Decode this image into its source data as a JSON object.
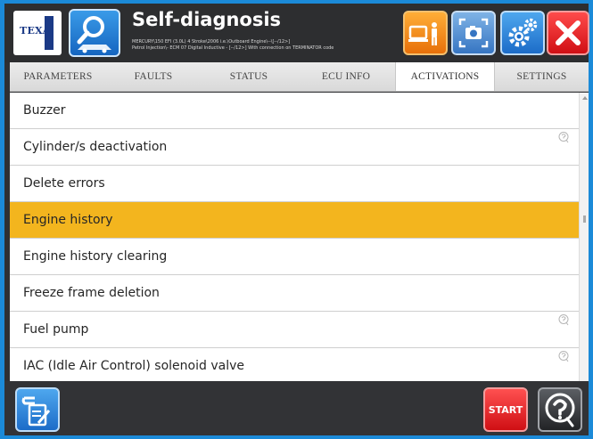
{
  "app": {
    "logo_text": "TEXA",
    "title": "Self-diagnosis",
    "subtitle_line1": "MERCURY\\150 EFI (3.0L) 4 Stroke\\2006 i.e.\\Outboard Engine\\--\\[--/12>]",
    "subtitle_line2": "Petrol Injection\\- ECM 07 Digital Inductive - [--/12>] With connection on TERMINATOR code"
  },
  "header_buttons": [
    {
      "name": "connection-icon"
    },
    {
      "name": "screenshot-icon"
    },
    {
      "name": "settings-gear-icon"
    },
    {
      "name": "close-icon"
    }
  ],
  "tabs": [
    {
      "label": "PARAMETERS"
    },
    {
      "label": "FAULTS"
    },
    {
      "label": "STATUS"
    },
    {
      "label": "ECU INFO"
    },
    {
      "label": "ACTIVATIONS"
    },
    {
      "label": "SETTINGS"
    }
  ],
  "list": {
    "items": [
      {
        "label": "Buzzer",
        "has_help": false,
        "selected": false
      },
      {
        "label": "Cylinder/s deactivation",
        "has_help": true,
        "selected": false
      },
      {
        "label": "Delete errors",
        "has_help": false,
        "selected": false
      },
      {
        "label": "Engine history",
        "has_help": false,
        "selected": true
      },
      {
        "label": "Engine history clearing",
        "has_help": false,
        "selected": false
      },
      {
        "label": "Freeze frame deletion",
        "has_help": false,
        "selected": false
      },
      {
        "label": "Fuel pump",
        "has_help": true,
        "selected": false
      },
      {
        "label": "IAC (Idle Air Control) solenoid valve",
        "has_help": true,
        "selected": false
      }
    ]
  },
  "footer": {
    "start_label": "START"
  },
  "colors": {
    "accent_blue": "#1b8ad8",
    "selected_row": "#f3b51e",
    "header_bg": "#2d2e30"
  }
}
